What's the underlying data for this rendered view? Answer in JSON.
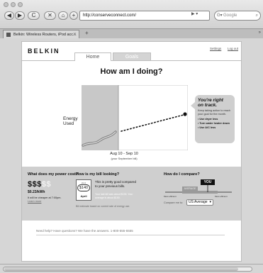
{
  "browser": {
    "url": "http://conserveconnect.com/",
    "search_placeholder": "Google",
    "tab_title": "Belkin: Wireless Routers, iPod acc...",
    "nav": {
      "back": "◀",
      "forward": "▶",
      "reload": "C",
      "home": "⌂",
      "add": "+"
    }
  },
  "header": {
    "logo": "BELKIN",
    "settings_link": "Settings",
    "logout_link": "Log out"
  },
  "tabs": [
    {
      "label": "Home",
      "active": true
    },
    {
      "label": "Goals",
      "active": false
    }
  ],
  "main": {
    "headline": "How am I doing?",
    "energy_label_line1": "Energy",
    "energy_label_line2": "Used",
    "today_label": "Today",
    "goal_label_line1": "Your",
    "goal_label_line2": "Goal",
    "date_range": "Aug 10 - Sep 10",
    "date_sub": "(your September bill)"
  },
  "callout": {
    "title_line1": "You're right",
    "title_line2": "on track.",
    "body": "Keep taking action to reach your goal for the month.",
    "items": [
      "Use dryer less",
      "Turn water heater down",
      "Use A/C less"
    ]
  },
  "cost": {
    "title": "What does my power cost?",
    "dollars_dark": "$$$",
    "dollars_light": "$$",
    "rate": "$0.23/kWh",
    "note": "It will be cheaper at 7:00pm.",
    "link": "Learn more"
  },
  "bill": {
    "title": "How is my bill looking?",
    "icon_small": "about",
    "amount": "$140",
    "month": "April",
    "main": "This is pretty good compared to your previous bills.",
    "detail": "Your last bill was about $135. Your average is about $150.",
    "footnote": "Bill estimate based on current rate of energy use."
  },
  "compare": {
    "title": "How do I compare?",
    "you_label": "YOU",
    "avg_label": "AVERAGE",
    "low_label": "Most efficient",
    "high_label": "Most efficient",
    "compare_to": "Compare me to:",
    "select_value": "US Average"
  },
  "footer": {
    "help": "Need help? Have questions? We have the answers. 1-800-555-5555"
  }
}
